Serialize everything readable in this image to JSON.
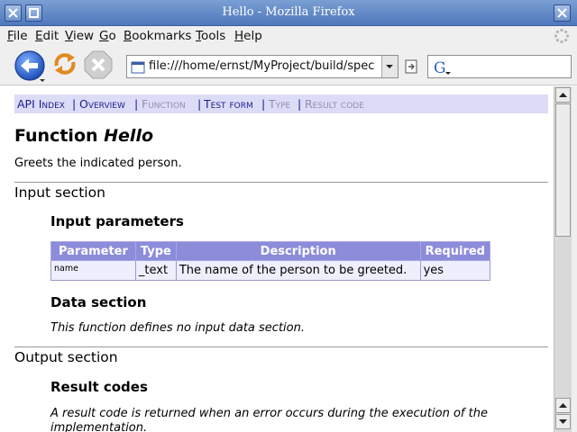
{
  "window": {
    "title": "Hello - Mozilla Firefox"
  },
  "menu": {
    "items": [
      "File",
      "Edit",
      "View",
      "Go",
      "Bookmarks",
      "Tools",
      "Help"
    ]
  },
  "toolbar": {
    "url": "file:///home/ernst/MyProject/build/specdoc",
    "search_engine_icon": "google-g-icon"
  },
  "nav_strip": {
    "api_index": "API Index",
    "sep": "|",
    "overview": "Overview",
    "function": "Function",
    "test_form": "Test form",
    "type": "Type",
    "result_code": "Result code"
  },
  "page": {
    "title_prefix": "Function ",
    "title_name": "Hello",
    "description": "Greets the indicated person.",
    "input_section": "Input section",
    "input_parameters": "Input parameters",
    "table": {
      "headers": [
        "Parameter",
        "Type",
        "Description",
        "Required"
      ],
      "rows": [
        [
          "name",
          "_text",
          "The name of the person to be greeted.",
          "yes"
        ]
      ]
    },
    "data_section": "Data section",
    "data_section_text": "This function defines no input data section.",
    "output_section": "Output section",
    "result_codes": "Result codes",
    "result_codes_text": "A result code is returned when an error occurs during the execution of the implementation."
  },
  "colors": {
    "nav_strip_bg": "#dcdcf7",
    "table_header_bg": "#8c8cdb",
    "table_cell_bg": "#eeeefc",
    "titlebar": "#4f78bd"
  }
}
